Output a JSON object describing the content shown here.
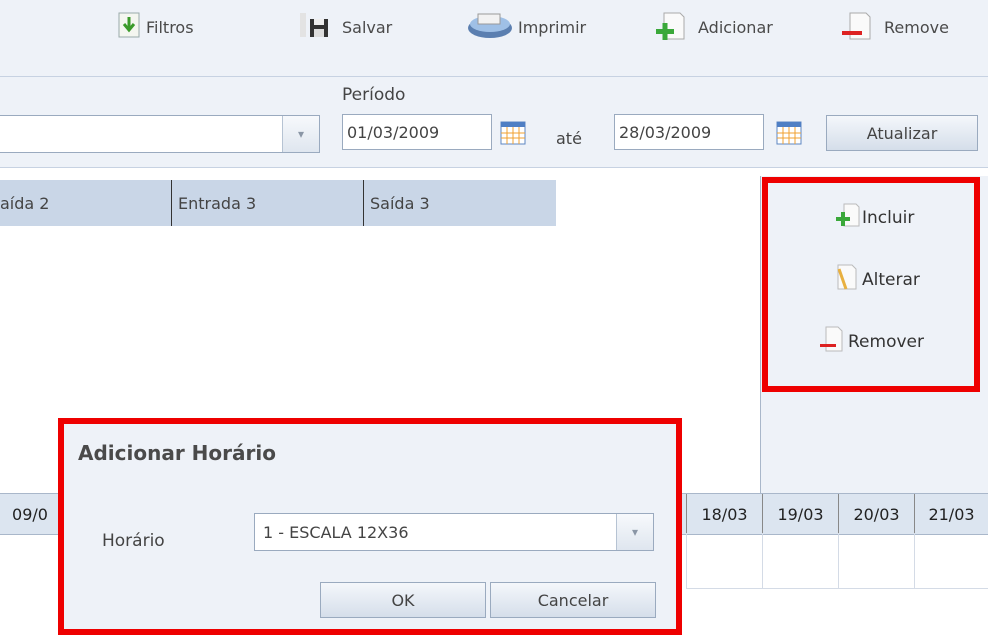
{
  "toolbar": {
    "filtros": "Filtros",
    "salvar": "Salvar",
    "imprimir": "Imprimir",
    "adicionar": "Adicionar",
    "remover": "Remove"
  },
  "filter": {
    "periodo_label": "Período",
    "date_from": "01/03/2009",
    "ate_label": "até",
    "date_to": "28/03/2009",
    "atualizar": "Atualizar"
  },
  "grid": {
    "columns": [
      "aída 2",
      "Entrada 3",
      "Saída 3"
    ]
  },
  "side": {
    "incluir": "Incluir",
    "alterar": "Alterar",
    "remover": "Remover"
  },
  "days": [
    "09/0",
    "18/03",
    "19/03",
    "20/03",
    "21/03"
  ],
  "dialog": {
    "title": "Adicionar Horário",
    "field_label": "Horário",
    "selected": "1 - ESCALA 12X36",
    "ok": "OK",
    "cancel": "Cancelar"
  },
  "colors": {
    "highlight": "#ee0000",
    "panel_bg": "#eef2f8",
    "header_bg": "#c9d6e7"
  }
}
